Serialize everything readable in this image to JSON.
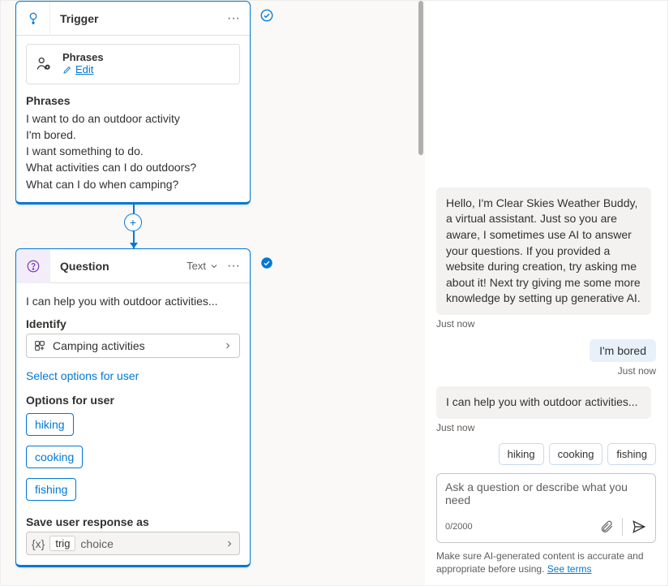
{
  "trigger": {
    "title": "Trigger",
    "phrases_card_title": "Phrases",
    "edit_label": "Edit",
    "section_label": "Phrases",
    "phrases": [
      "I want to do an outdoor activity",
      "I'm bored.",
      "I want something to do.",
      "What activities can I do outdoors?",
      "What can I do when camping?"
    ]
  },
  "question": {
    "title": "Question",
    "badge": "Text",
    "prompt": "I can help you with outdoor activities...",
    "identify_label": "Identify",
    "identify_value": "Camping activities",
    "select_options_link": "Select options for user",
    "options_label": "Options for user",
    "options": [
      "hiking",
      "cooking",
      "fishing"
    ],
    "save_label": "Save user response as",
    "var_name": "trig",
    "var_subtype": "choice"
  },
  "chat": {
    "bot_intro": "Hello, I'm Clear Skies Weather Buddy, a virtual assistant. Just so you are aware, I sometimes use AI to answer your questions. If you provided a website during creation, try asking me about it! Next try giving me some more knowledge by setting up generative AI.",
    "ts_just_now": "Just now",
    "user_msg": "I'm bored",
    "bot_reply": "I can help you with outdoor activities...",
    "suggestions": [
      "hiking",
      "cooking",
      "fishing"
    ],
    "placeholder": "Ask a question or describe what you need",
    "counter": "0/2000",
    "disclaimer_prefix": "Make sure AI-generated content is accurate and appropriate before using. ",
    "disclaimer_link": "See terms"
  }
}
